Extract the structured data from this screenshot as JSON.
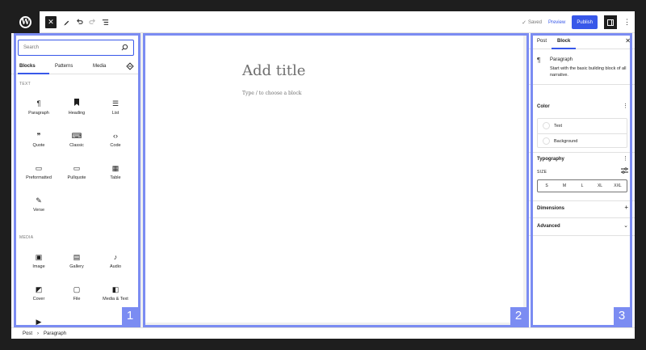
{
  "toolbar": {
    "logo_letter": "W",
    "toggle_inserter": "✕",
    "tools_icon": "pen-icon",
    "saved_label": "Saved",
    "preview_label": "Preview",
    "publish_label": "Publish"
  },
  "inserter": {
    "search_placeholder": "Search",
    "tabs": [
      "Blocks",
      "Patterns",
      "Media"
    ],
    "categories": {
      "text": "TEXT",
      "media": "MEDIA"
    },
    "text_blocks": [
      {
        "label": "Paragraph",
        "icon": "¶"
      },
      {
        "label": "Heading",
        "icon": "🔖"
      },
      {
        "label": "List",
        "icon": "☰"
      },
      {
        "label": "Quote",
        "icon": "❞"
      },
      {
        "label": "Classic",
        "icon": "⌨"
      },
      {
        "label": "Code",
        "icon": "‹›"
      },
      {
        "label": "Preformatted",
        "icon": "▭"
      },
      {
        "label": "Pullquote",
        "icon": "▭"
      },
      {
        "label": "Table",
        "icon": "▦"
      },
      {
        "label": "Verse",
        "icon": "✎"
      }
    ],
    "media_blocks": [
      {
        "label": "Image",
        "icon": "▣"
      },
      {
        "label": "Gallery",
        "icon": "▤"
      },
      {
        "label": "Audio",
        "icon": "♪"
      },
      {
        "label": "Cover",
        "icon": "◩"
      },
      {
        "label": "File",
        "icon": "▢"
      },
      {
        "label": "Media & Text",
        "icon": "◧"
      }
    ]
  },
  "canvas": {
    "title_placeholder": "Add title",
    "block_hint": "Type / to choose a block"
  },
  "sidebar": {
    "tabs": [
      "Post",
      "Block"
    ],
    "block_name": "Paragraph",
    "block_description": "Start with the basic building block of all narrative.",
    "color_heading": "Color",
    "color_text": "Text",
    "color_background": "Background",
    "typography_heading": "Typography",
    "size_label": "SIZE",
    "sizes": [
      "S",
      "M",
      "L",
      "XL",
      "XXL"
    ],
    "dimensions_heading": "Dimensions",
    "advanced_heading": "Advanced"
  },
  "footer": {
    "breadcrumb": [
      "Post",
      "Paragraph"
    ]
  },
  "overlays": [
    "1",
    "2",
    "3"
  ],
  "colors": {
    "accent": "#3858e9",
    "overlay": "#7b8cf2",
    "frame": "#1e1e1e"
  }
}
